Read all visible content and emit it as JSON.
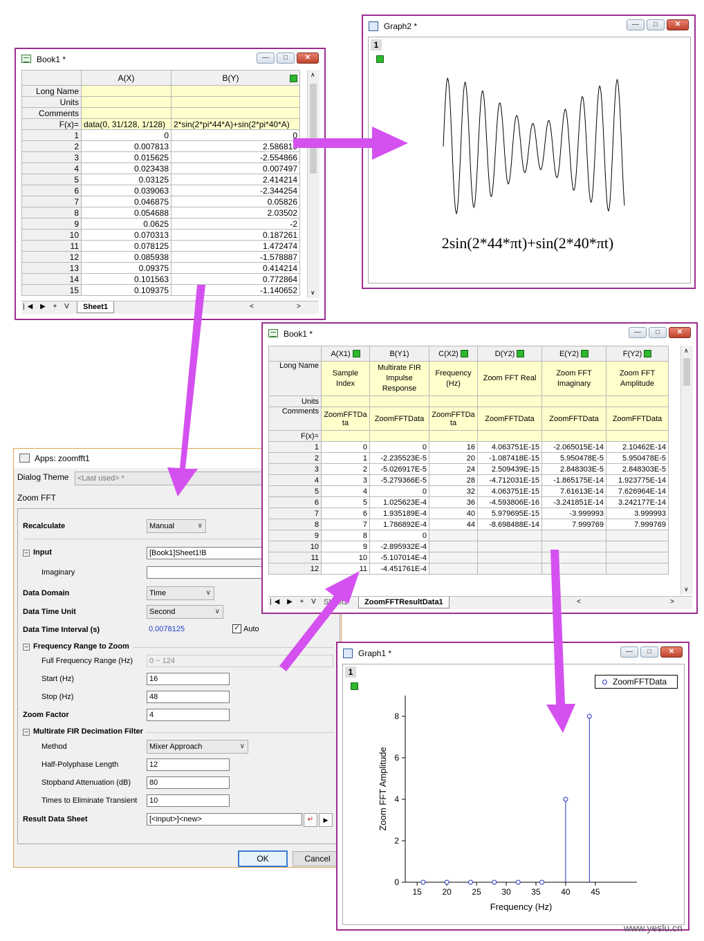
{
  "book1_top": {
    "title": "Book1 *",
    "columns": [
      "A(X)",
      "B(Y)"
    ],
    "label_rows": [
      "Long Name",
      "Units",
      "Comments",
      "F(x)="
    ],
    "formula_a": "data(0, 31/128, 1/128)",
    "formula_b": "2*sin(2*pi*44*A)+sin(2*pi*40*A)",
    "rows": [
      [
        "1",
        "0",
        "0"
      ],
      [
        "2",
        "0.007813",
        "2.586819"
      ],
      [
        "3",
        "0.015625",
        "-2.554866"
      ],
      [
        "4",
        "0.023438",
        "0.007497"
      ],
      [
        "5",
        "0.03125",
        "2.414214"
      ],
      [
        "6",
        "0.039063",
        "-2.344254"
      ],
      [
        "7",
        "0.046875",
        "0.05826"
      ],
      [
        "8",
        "0.054688",
        "2.03502"
      ],
      [
        "9",
        "0.0625",
        "-2"
      ],
      [
        "10",
        "0.070313",
        "0.187261"
      ],
      [
        "11",
        "0.078125",
        "1.472474"
      ],
      [
        "12",
        "0.085938",
        "-1.578887"
      ],
      [
        "13",
        "0.09375",
        "0.414214"
      ],
      [
        "14",
        "0.101563",
        "0.772864"
      ],
      [
        "15",
        "0.109375",
        "-1.140652"
      ]
    ],
    "sheet_tab": "Sheet1",
    "nav_buttons": [
      "|◀",
      "▶",
      "+",
      "V"
    ]
  },
  "graph2": {
    "title": "Graph2 *",
    "layer": "1",
    "formula": "2sin(2*44*πt)+sin(2*40*πt)"
  },
  "book1_mid": {
    "title": "Book1 *",
    "columns": [
      "A(X1)",
      "B(Y1)",
      "C(X2)",
      "D(Y2)",
      "E(Y2)",
      "F(Y2)"
    ],
    "long_names": [
      "Sample Index",
      "Multirate FIR Impulse Response",
      "Frequency (Hz)",
      "Zoom FFT Real",
      "Zoom FFT Imaginary",
      "Zoom FFT Amplitude"
    ],
    "label_rows": [
      "Long Name",
      "Units",
      "Comments",
      "F(x)="
    ],
    "comments": [
      "ZoomFFTData",
      "ZoomFFTData",
      "ZoomFFTData",
      "ZoomFFTData",
      "ZoomFFTData",
      "ZoomFFTData"
    ],
    "rows": [
      [
        "1",
        "0",
        "0",
        "16",
        "4.063751E-15",
        "-2.065015E-14",
        "2.10462E-14"
      ],
      [
        "2",
        "1",
        "-2.235523E-5",
        "20",
        "-1.087418E-15",
        "5.950478E-5",
        "5.950478E-5"
      ],
      [
        "3",
        "2",
        "-5.026917E-5",
        "24",
        "2.509439E-15",
        "2.848303E-5",
        "2.848303E-5"
      ],
      [
        "4",
        "3",
        "-5.279366E-5",
        "28",
        "-4.712031E-15",
        "-1.865175E-14",
        "1.923775E-14"
      ],
      [
        "5",
        "4",
        "0",
        "32",
        "4.063751E-15",
        "7.61613E-14",
        "7.626964E-14"
      ],
      [
        "6",
        "5",
        "1.025623E-4",
        "36",
        "-4.593806E-16",
        "-3.241851E-14",
        "3.242177E-14"
      ],
      [
        "7",
        "6",
        "1.935189E-4",
        "40",
        "5.979695E-15",
        "-3.999993",
        "3.999993"
      ],
      [
        "8",
        "7",
        "1.786892E-4",
        "44",
        "-8.698488E-14",
        "7.999769",
        "7.999769"
      ],
      [
        "9",
        "8",
        "0",
        "",
        "",
        "",
        ""
      ],
      [
        "10",
        "9",
        "-2.895932E-4",
        "",
        "",
        "",
        ""
      ],
      [
        "11",
        "10",
        "-5.107014E-4",
        "",
        "",
        "",
        ""
      ],
      [
        "12",
        "11",
        "-4.451761E-4",
        "",
        "",
        "",
        ""
      ]
    ],
    "sheet_tabs": [
      "Sheet1",
      "ZoomFFTResultData1"
    ]
  },
  "dialog": {
    "title": "Apps: zoomfft1",
    "theme_label": "Dialog Theme",
    "theme_value": "<Last used> *",
    "section_title": "Zoom FFT",
    "recalculate_label": "Recalculate",
    "recalculate_value": "Manual",
    "input_label": "Input",
    "input_value": "[Book1]Sheet1!B",
    "imaginary_label": "Imaginary",
    "imaginary_value": "",
    "data_domain_label": "Data Domain",
    "data_domain_value": "Time",
    "data_time_unit_label": "Data Time Unit",
    "data_time_unit_value": "Second",
    "data_time_interval_label": "Data Time Interval (s)",
    "data_time_interval_value": "0.0078125",
    "auto_label": "Auto",
    "freq_range_label": "Frequency Range to Zoom",
    "full_freq_label": "Full Frequency Range (Hz)",
    "full_freq_value": "0 ~ 124",
    "start_label": "Start (Hz)",
    "start_value": "16",
    "stop_label": "Stop (Hz)",
    "stop_value": "48",
    "zoom_factor_label": "Zoom Factor",
    "zoom_factor_value": "4",
    "fir_label": "Multirate FIR Decimation Filter",
    "method_label": "Method",
    "method_value": "Mixer Approach",
    "half_poly_label": "Half-Polyphase Length",
    "half_poly_value": "12",
    "stopband_label": "Stopband Attenuation (dB)",
    "stopband_value": "80",
    "transient_label": "Times to Eliminate Transient",
    "transient_value": "10",
    "result_label": "Result Data Sheet",
    "result_value": "[<input>]<new>",
    "ok_label": "OK",
    "cancel_label": "Cancel"
  },
  "graph1": {
    "title": "Graph1 *",
    "layer": "1",
    "legend": "ZoomFFTData"
  },
  "chart_data": {
    "type": "scatter",
    "series": [
      {
        "name": "ZoomFFTData",
        "x": [
          16,
          20,
          24,
          28,
          32,
          36,
          40,
          44
        ],
        "y": [
          0,
          5.95e-05,
          2.85e-05,
          0,
          0,
          0,
          3.999993,
          7.999769
        ]
      }
    ],
    "xlabel": "Frequency (Hz)",
    "ylabel": "Zoom FFT Amplitude",
    "xlim": [
      13,
      52
    ],
    "ylim": [
      0,
      9
    ],
    "xticks": [
      "15",
      "20",
      "25",
      "30",
      "35",
      "40",
      "45"
    ],
    "yticks": [
      "0",
      "2",
      "4",
      "6",
      "8"
    ],
    "drop_lines": true,
    "legend_position": "top-right"
  },
  "watermark": "www.yeslu.cn",
  "colors": {
    "arrow": "#d451f0",
    "window_border": "#9b2d8f",
    "series": "#1f2fbf"
  }
}
